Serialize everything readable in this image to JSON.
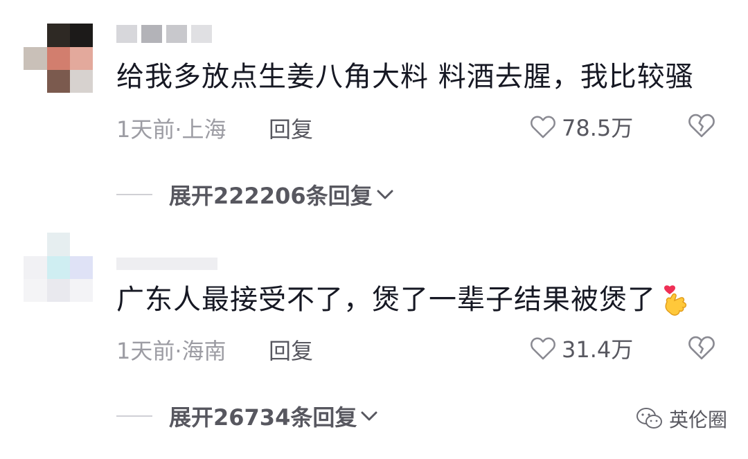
{
  "comments": [
    {
      "text": "给我多放点生姜八角大料 料酒去腥，我比较骚",
      "time_location": "1天前·上海",
      "reply_label": "回复",
      "likes": "78.5万",
      "expand_label": "展开222206条回复"
    },
    {
      "text": "广东人最接受不了，煲了一辈子结果被煲了",
      "time_location": "1天前·海南",
      "reply_label": "回复",
      "likes": "31.4万",
      "expand_label": "展开26734条回复"
    }
  ],
  "watermark": "英伦圈",
  "icons": {
    "like": "heart-outline-icon",
    "dislike": "broken-heart-icon",
    "expand": "chevron-down-icon",
    "emoji": "heart-fingers-emoji-icon",
    "watermark": "wechat-icon"
  },
  "colors": {
    "text": "#161823",
    "meta": "#9c9ca3",
    "action": "#57575f"
  }
}
